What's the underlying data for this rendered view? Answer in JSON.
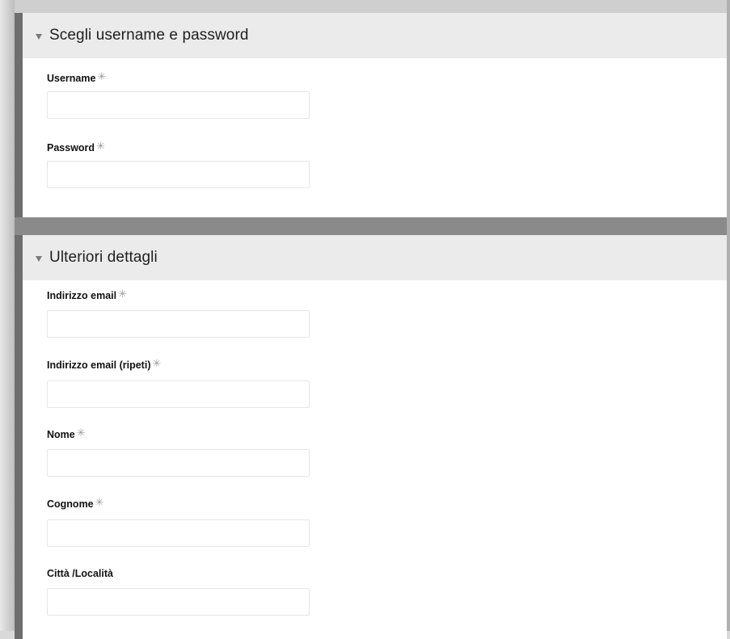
{
  "sections": [
    {
      "title": "Scegli username e password",
      "fields": [
        {
          "label": "Username",
          "required_mark": "✳",
          "value": ""
        },
        {
          "label": "Password",
          "required_mark": "✳",
          "value": ""
        }
      ]
    },
    {
      "title": "Ulteriori dettagli",
      "fields": [
        {
          "label": "Indirizzo email",
          "required_mark": "✳",
          "value": ""
        },
        {
          "label": "Indirizzo email (ripeti)",
          "required_mark": "✳",
          "value": ""
        },
        {
          "label": "Nome",
          "required_mark": "✳",
          "value": ""
        },
        {
          "label": "Cognome",
          "required_mark": "✳",
          "value": ""
        },
        {
          "label": "Città /Località",
          "value": ""
        }
      ]
    }
  ],
  "icons": {
    "collapse": "triangle-down-icon",
    "required": "asterisk-icon"
  },
  "colors": {
    "header_bg": "#ebebeb",
    "card_border": "#6e6e6e",
    "required_mark": "#9a9a9a"
  }
}
